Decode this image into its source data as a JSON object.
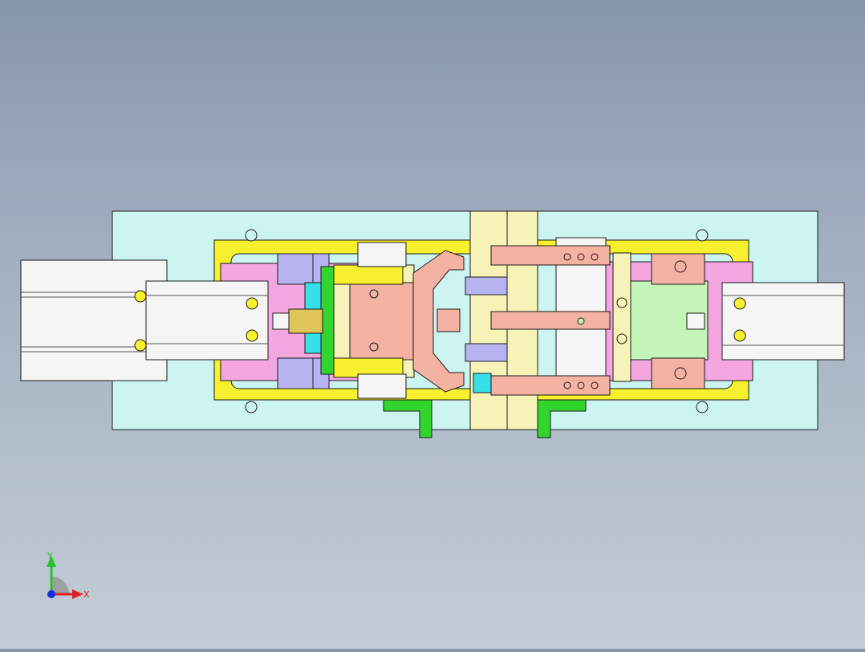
{
  "viewport": {
    "background_top": "#8797ab",
    "background_bottom": "#c3ccd6"
  },
  "model": {
    "colors": {
      "base_plate": "#ccf5f1",
      "outline": "#1a1a1a",
      "yellow_frame": "#f7f02e",
      "pink": "#f3a6e0",
      "salmon": "#f4b2a2",
      "lavender": "#b7b3f0",
      "cyan": "#37e0e8",
      "green": "#33d42d",
      "light_green": "#c3f5b8",
      "cream": "#f7f3b8",
      "white_part": "#f5f5f5",
      "gold": "#e0c55a"
    }
  },
  "triad": {
    "y_label": "Y",
    "x_label": "X",
    "y_color": "#27c22b",
    "x_color": "#e02020",
    "origin_color": "#1a2be0"
  }
}
